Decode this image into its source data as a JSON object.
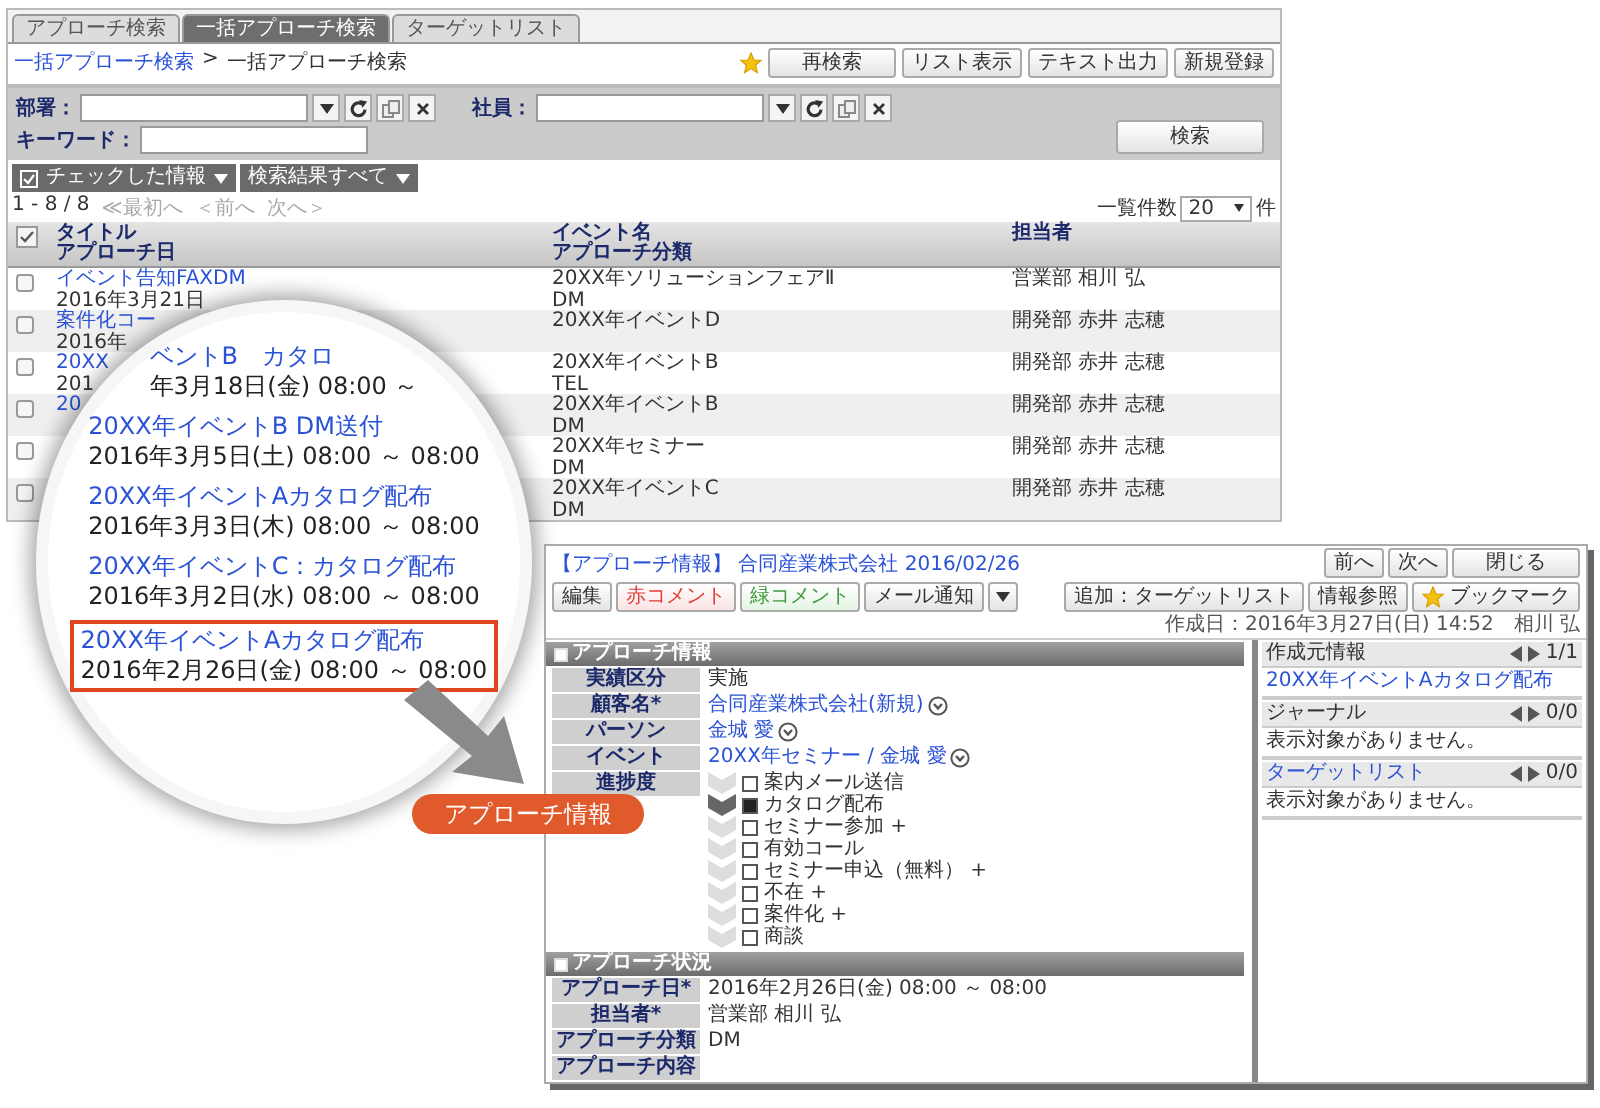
{
  "back_window": {
    "tabs": [
      {
        "label": "アプローチ検索",
        "selected": false
      },
      {
        "label": "一括アプローチ検索",
        "selected": true
      },
      {
        "label": "ターゲットリスト",
        "selected": false
      }
    ],
    "breadcrumb": {
      "link": "一括アプローチ検索",
      "separator": ">",
      "current": "一括アプローチ検索"
    },
    "toolbar_buttons": [
      "再検索",
      "リスト表示",
      "テキスト出力",
      "新規登録"
    ],
    "filters": [
      {
        "label": "部署：",
        "kind": "picker"
      },
      {
        "label": "社員：",
        "kind": "picker"
      },
      {
        "label": "キーワード：",
        "kind": "text"
      }
    ],
    "search_button": "検索",
    "action_menus": [
      {
        "label": "チェックした情報",
        "kind": "checkbox-menu"
      },
      {
        "label": "検索結果すべて",
        "kind": "menu"
      }
    ],
    "pager": {
      "range": "1 - 8 / 8",
      "links": [
        {
          "label": "≪最初へ",
          "disabled": true
        },
        {
          "label": "＜前へ",
          "disabled": true
        },
        {
          "label": "次へ＞",
          "disabled": true
        }
      ]
    },
    "page_size": {
      "label": "一覧件数",
      "value": "20",
      "unit": "件"
    },
    "header_checkbox": {
      "checked": true
    },
    "columns": [
      {
        "line_1": "タイトル",
        "line_2": "アプローチ日"
      },
      {
        "line_1": "イベント名",
        "line_2": "アプローチ分類"
      },
      {
        "line_1": "担当者"
      }
    ],
    "rows": [
      {
        "checked": false,
        "title": "イベント告知FAXDM",
        "date": "2016年3月21日",
        "event": "20XX年ソリューションフェアⅡ",
        "category": "DM",
        "owner": "営業部 相川 弘"
      },
      {
        "checked": false,
        "title": "案件化コー",
        "date": "2016年",
        "event": "20XX年イベントD",
        "owner": "開発部 赤井 志穂"
      },
      {
        "checked": false,
        "title": "20XX",
        "date": "201",
        "event": "20XX年イベントB",
        "category": "TEL",
        "owner": "開発部 赤井 志穂"
      },
      {
        "checked": false,
        "title": "20",
        "event": "20XX年イベントB",
        "category": "DM",
        "owner": "開発部 赤井 志穂"
      },
      {
        "checked": false,
        "event": "20XX年セミナー",
        "category": "DM",
        "owner": "開発部 赤井 志穂"
      },
      {
        "checked": false,
        "event": "20XX年イベントC",
        "category": "DM",
        "owner": "開発部 赤井 志穂"
      }
    ]
  },
  "magnifier": {
    "entries": [
      {
        "title": "ベントB　カタロ",
        "date": "年3月18日(金) 08:00 ～",
        "selected": false
      },
      {
        "title": "20XX年イベントB DM送付",
        "date": "2016年3月5日(土) 08:00 ～ 08:00",
        "selected": false
      },
      {
        "title": "20XX年イベントAカタログ配布",
        "date": "2016年3月3日(木) 08:00 ～ 08:00",
        "selected": false
      },
      {
        "title": "20XX年イベントC：カタログ配布",
        "date": "2016年3月2日(水) 08:00 ～ 08:00",
        "selected": false
      },
      {
        "title": "20XX年イベントAカタログ配布",
        "date": "2016年2月26日(金) 08:00 ～ 08:00",
        "selected": true
      }
    ]
  },
  "callout": {
    "label": "アプローチ情報"
  },
  "detail_window": {
    "title": "【アプローチ情報】 合同産業株式会社 2016/02/26",
    "nav_buttons": [
      "前へ",
      "次へ",
      "閉じる"
    ],
    "left_buttons": [
      {
        "label": "編集",
        "kind": "plain"
      },
      {
        "label": "赤コメント",
        "kind": "red"
      },
      {
        "label": "緑コメント",
        "kind": "green"
      },
      {
        "label": "メール通知",
        "kind": "dropdown"
      }
    ],
    "right_buttons": [
      {
        "label": "追加：ターゲットリスト",
        "kind": "plain"
      },
      {
        "label": "情報参照",
        "kind": "plain"
      },
      {
        "label": "ブックマーク",
        "kind": "star"
      }
    ],
    "created": "作成日：2016年3月27日(日) 14:52　相川 弘",
    "sections": [
      {
        "title": "アプローチ情報",
        "fields": [
          {
            "label": "実績区分",
            "kind": "text",
            "value": "実施"
          },
          {
            "label": "顧客名*",
            "kind": "link",
            "value": "合同産業株式会社(新規)"
          },
          {
            "label": "パーソン",
            "kind": "link",
            "value": "金城 愛"
          },
          {
            "label": "イベント",
            "kind": "link",
            "value": "20XX年セミナー / 金城 愛"
          },
          {
            "label": "進捗度",
            "kind": "progress",
            "steps": [
              {
                "label": "案内メール送信",
                "checked": false
              },
              {
                "label": "カタログ配布",
                "checked": true
              },
              {
                "label": "セミナー参加 +",
                "checked": false
              },
              {
                "label": "有効コール",
                "checked": false
              },
              {
                "label": "セミナー申込（無料） +",
                "checked": false
              },
              {
                "label": "不在 +",
                "checked": false
              },
              {
                "label": "案件化 +",
                "checked": false
              },
              {
                "label": "商談",
                "checked": false
              }
            ]
          }
        ]
      },
      {
        "title": "アプローチ状況",
        "fields": [
          {
            "label": "アプローチ日*",
            "kind": "text",
            "value": "2016年2月26日(金) 08:00 ～ 08:00"
          },
          {
            "label": "担当者*",
            "kind": "text",
            "value": "営業部 相川 弘"
          },
          {
            "label": "アプローチ分類",
            "kind": "text",
            "value": "DM"
          },
          {
            "label": "アプローチ内容",
            "kind": "text"
          }
        ]
      }
    ],
    "side_panels": [
      {
        "title": {
          "text": "作成元情報",
          "kind": "text"
        },
        "counter": "1/1",
        "content": {
          "text": "20XX年イベントAカタログ配布",
          "kind": "link"
        }
      },
      {
        "title": {
          "text": "ジャーナル",
          "kind": "text"
        },
        "counter": "0/0",
        "content": {
          "text": "表示対象がありません。",
          "kind": "text"
        }
      },
      {
        "title": {
          "text": "ターゲットリスト",
          "kind": "link"
        },
        "counter": "0/0",
        "content": {
          "text": "表示対象がありません。",
          "kind": "text"
        }
      }
    ]
  }
}
